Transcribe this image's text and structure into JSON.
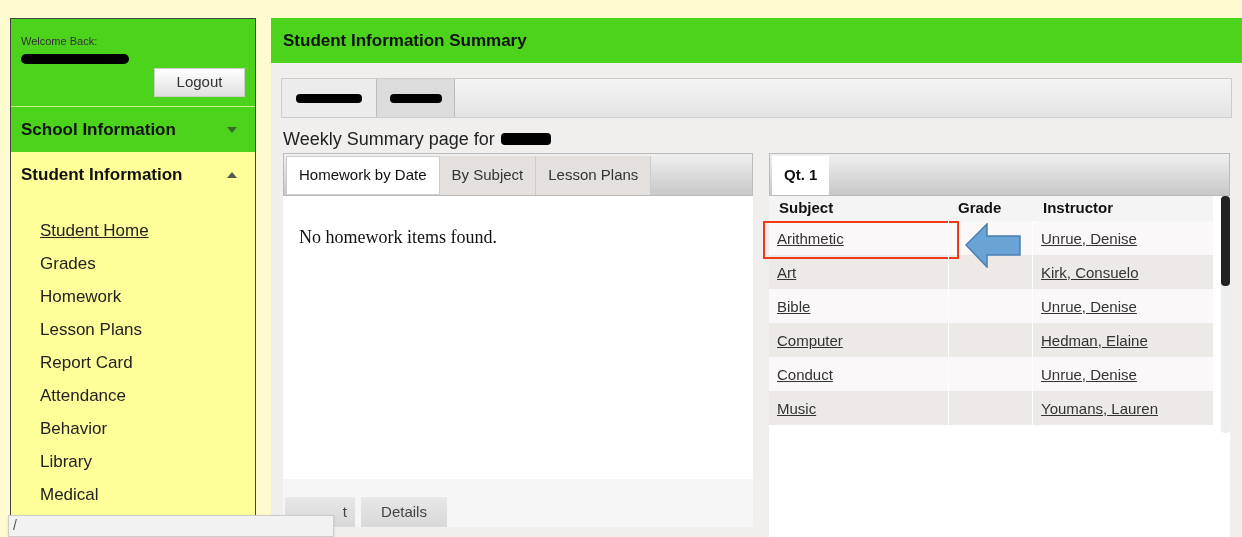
{
  "sidebar": {
    "welcome": "Welcome Back:",
    "logout": "Logout",
    "sections": [
      {
        "title": "School Information",
        "expanded": false
      },
      {
        "title": "Student Information",
        "expanded": true,
        "items": [
          {
            "label": "Student Home",
            "selected": true
          },
          {
            "label": "Grades",
            "selected": false
          },
          {
            "label": "Homework",
            "selected": false
          },
          {
            "label": "Lesson Plans",
            "selected": false
          },
          {
            "label": "Report Card",
            "selected": false
          },
          {
            "label": "Attendance",
            "selected": false
          },
          {
            "label": "Behavior",
            "selected": false
          },
          {
            "label": "Library",
            "selected": false
          },
          {
            "label": "Medical",
            "selected": false
          }
        ]
      }
    ]
  },
  "main": {
    "title": "Student Information Summary",
    "student_tabs": [
      {
        "selected": false
      },
      {
        "selected": true
      }
    ],
    "weekly_label": "Weekly Summary page for",
    "homework": {
      "tabs": [
        {
          "label": "Homework by Date",
          "selected": true
        },
        {
          "label": "By Subject",
          "selected": false
        },
        {
          "label": "Lesson Plans",
          "selected": false
        }
      ],
      "message": "No homework items found.",
      "bottom_tabs": [
        {
          "label": "t",
          "selected": false
        },
        {
          "label": "Details",
          "selected": false
        }
      ]
    },
    "grades": {
      "tabs": [
        {
          "label": "Qt. 1",
          "selected": true
        }
      ],
      "columns": [
        "Subject",
        "Grade",
        "Instructor"
      ],
      "rows": [
        {
          "subject": "Arithmetic",
          "instructor": "Unrue, Denise",
          "highlighted": true
        },
        {
          "subject": "Art",
          "instructor": "Kirk, Consuelo",
          "highlighted": false
        },
        {
          "subject": "Bible",
          "instructor": "Unrue, Denise",
          "highlighted": false
        },
        {
          "subject": "Computer",
          "instructor": "Hedman, Elaine",
          "highlighted": false
        },
        {
          "subject": "Conduct",
          "instructor": "Unrue, Denise",
          "highlighted": false
        },
        {
          "subject": "Music",
          "instructor": "Youmans, Lauren",
          "highlighted": false
        }
      ]
    }
  },
  "popup": {
    "text": "/"
  }
}
